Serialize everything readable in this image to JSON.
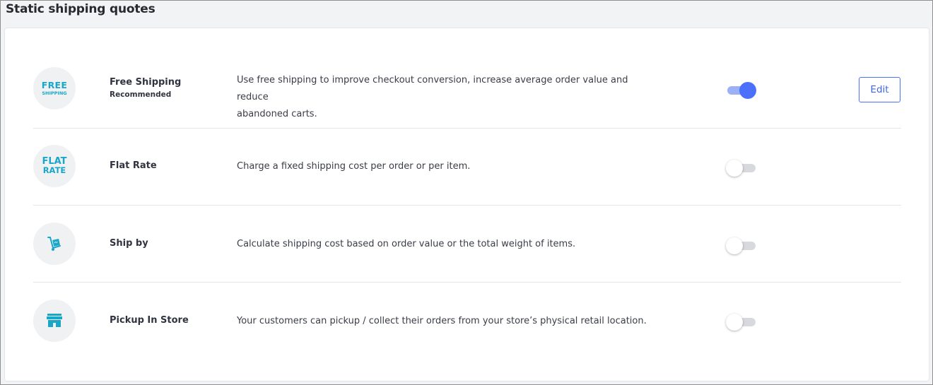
{
  "page": {
    "title": "Static shipping quotes"
  },
  "methods": [
    {
      "badge_line1": "FREE",
      "badge_line2": "SHIPPING",
      "name": "Free Shipping",
      "subtitle": "Recommended",
      "description_line1": "Use free shipping to improve checkout conversion, increase average order value and reduce",
      "description_line2": "abandoned carts.",
      "enabled": true,
      "edit_label": "Edit"
    },
    {
      "badge_line1": "FLAT",
      "badge_line2": "RATE",
      "name": "Flat Rate",
      "description": "Charge a fixed shipping cost per order or per item.",
      "enabled": false
    },
    {
      "icon": "hand-truck-icon",
      "name": "Ship by",
      "description": "Calculate shipping cost based on order value or the total weight of items.",
      "enabled": false
    },
    {
      "icon": "storefront-icon",
      "name": "Pickup In Store",
      "description": "Your customers can pickup / collect their orders from your store’s physical retail location.",
      "enabled": false
    }
  ],
  "colors": {
    "accent": "#4b71fc",
    "icon_teal": "#18a7c9"
  }
}
